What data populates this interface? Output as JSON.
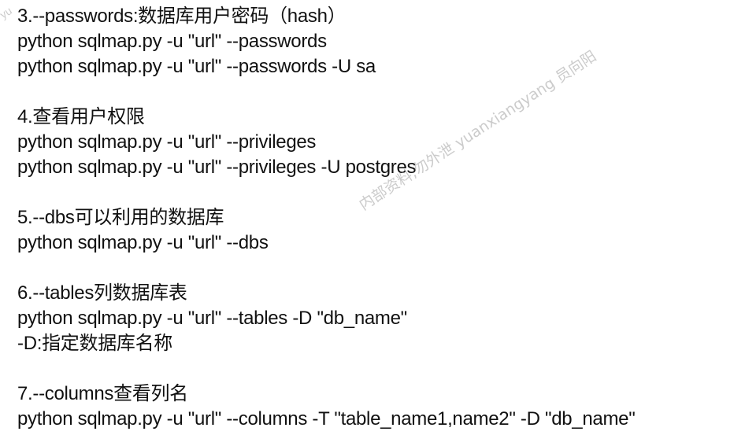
{
  "watermark_text": "内部资料,勿外泄 yuanxiangyang 员向阳",
  "corner_watermark": "yu",
  "sections": [
    {
      "heading": "3.--passwords:数据库用户密码（hash）",
      "lines": [
        "python sqlmap.py -u \"url\" --passwords",
        "python sqlmap.py -u \"url\" --passwords -U sa"
      ]
    },
    {
      "heading": "4.查看用户权限",
      "lines": [
        "python sqlmap.py -u \"url\" --privileges",
        "python sqlmap.py -u \"url\" --privileges -U postgres"
      ]
    },
    {
      "heading": "5.--dbs可以利用的数据库",
      "lines": [
        "python sqlmap.py -u \"url\" --dbs"
      ]
    },
    {
      "heading": "6.--tables列数据库表",
      "lines": [
        "python sqlmap.py -u \"url\" --tables -D \"db_name\"",
        "-D:指定数据库名称"
      ]
    },
    {
      "heading": "7.--columns查看列名",
      "lines": [
        "python sqlmap.py -u \"url\" --columns -T \"table_name1,name2\" -D \"db_name\""
      ]
    }
  ]
}
